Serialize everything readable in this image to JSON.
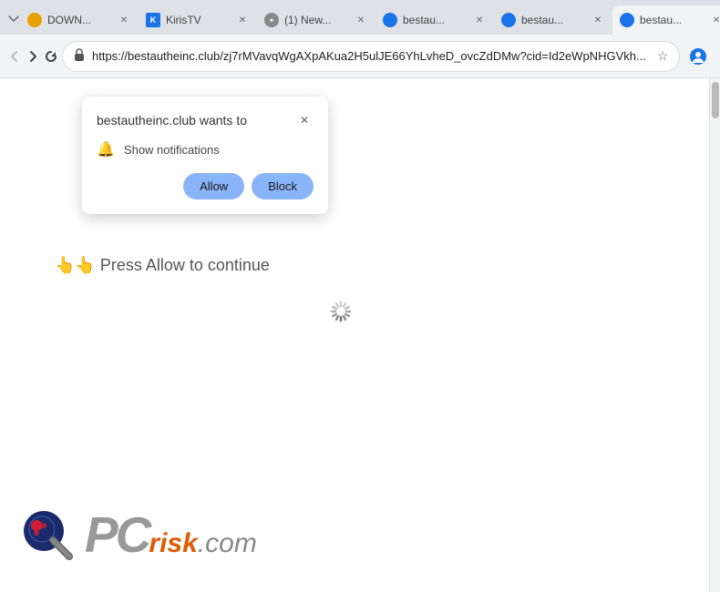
{
  "browser": {
    "tabs": [
      {
        "id": "tab1",
        "label": "DOWN...",
        "favicon": "orange",
        "active": false
      },
      {
        "id": "tab2",
        "label": "KirisTV",
        "favicon": "blue-k",
        "active": false
      },
      {
        "id": "tab3",
        "label": "(1) New...",
        "favicon": "dots",
        "active": false
      },
      {
        "id": "tab4",
        "label": "bestau...",
        "favicon": "bestau",
        "active": false
      },
      {
        "id": "tab5",
        "label": "bestau...",
        "favicon": "bestau2",
        "active": false
      },
      {
        "id": "tab6",
        "label": "bestau...",
        "favicon": "bestau3",
        "active": true
      }
    ],
    "url": "https://bestautheinc.club/zj7rMVavqWgAXpAKua2H5ulJE66YhLvheD_ovcZdDMw?cid=Id2eWpNHGVkh...",
    "window_controls": {
      "minimize": "—",
      "maximize": "□",
      "close": "✕"
    }
  },
  "popup": {
    "title": "bestautheinc.club wants to",
    "close_label": "✕",
    "notification_text": "Show notifications",
    "allow_label": "Allow",
    "block_label": "Block"
  },
  "page": {
    "body_text": "👆👆 Press Allow to continue"
  },
  "pcrisk": {
    "pc_text": "PC",
    "risk_text": "risk",
    "com_text": ".com"
  }
}
